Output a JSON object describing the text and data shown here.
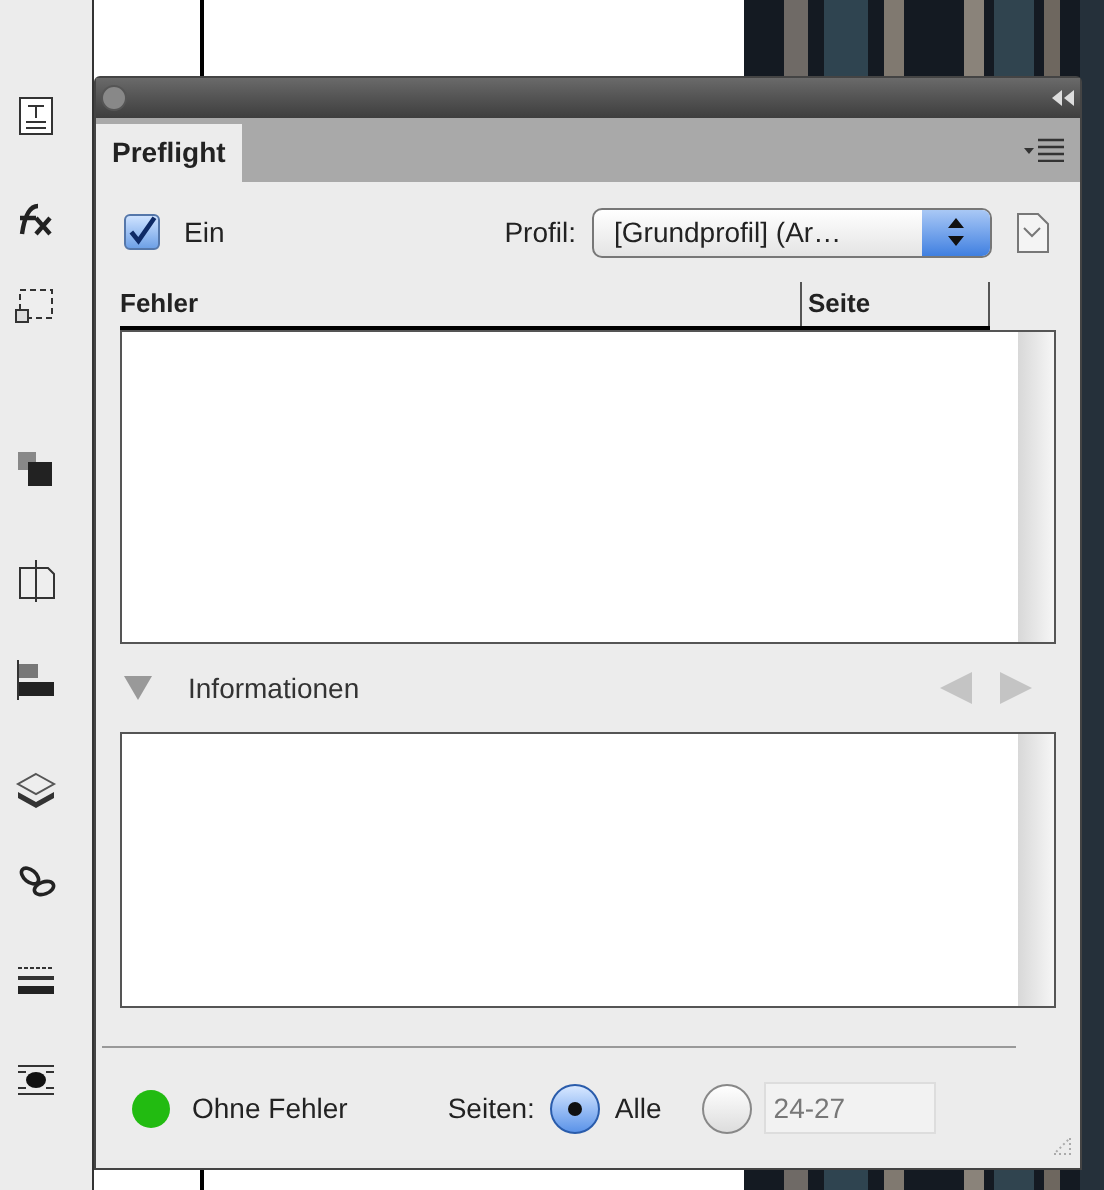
{
  "panel": {
    "tab": {
      "label": "Preflight",
      "selected": true
    },
    "on_checkbox": {
      "label": "Ein",
      "checked": true
    },
    "profile": {
      "label": "Profil:",
      "value": "[Grundprofil] (Ar…"
    },
    "errors_table": {
      "columns": [
        "Fehler",
        "Seite"
      ]
    },
    "info_section": {
      "label": "Informationen",
      "expanded": true
    },
    "status": {
      "text": "Ohne Fehler",
      "color": "#22bb11"
    },
    "pages": {
      "label": "Seiten:",
      "options": [
        {
          "label": "Alle",
          "selected": true
        },
        {
          "selected": false
        }
      ],
      "range_field": {
        "value": "24-27"
      }
    }
  }
}
